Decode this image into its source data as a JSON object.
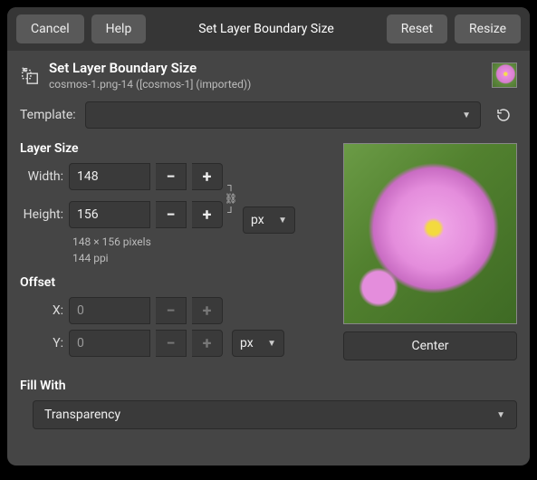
{
  "buttons": {
    "cancel": "Cancel",
    "help": "Help",
    "reset": "Reset",
    "resize": "Resize",
    "center": "Center"
  },
  "titlebar": "Set Layer Boundary Size",
  "header": {
    "title": "Set Layer Boundary Size",
    "subtitle": "cosmos-1.png-14 ([cosmos-1] (imported))"
  },
  "template": {
    "label": "Template:",
    "value": ""
  },
  "layer_size": {
    "title": "Layer Size",
    "width_label": "Width:",
    "width": "148",
    "height_label": "Height:",
    "height": "156",
    "unit": "px",
    "info1": "148 × 156 pixels",
    "info2": "144 ppi"
  },
  "offset": {
    "title": "Offset",
    "x_label": "X:",
    "x": "0",
    "y_label": "Y:",
    "y": "0",
    "unit": "px"
  },
  "fill": {
    "title": "Fill With",
    "value": "Transparency"
  }
}
